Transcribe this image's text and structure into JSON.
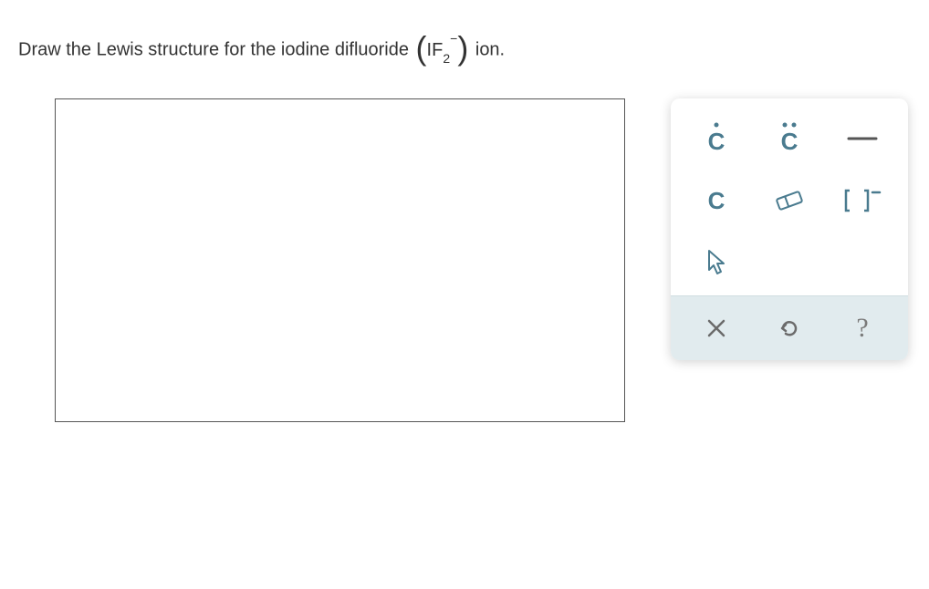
{
  "question": {
    "prefix": "Draw the Lewis structure for the iodine difluoride ",
    "formula_base": "IF",
    "formula_sub": "2",
    "formula_sup": "−",
    "suffix": " ion."
  },
  "tools": {
    "one_dot": "Ċ",
    "two_dot": "C̈",
    "bond": "—",
    "atom": "C",
    "eraser": "eraser",
    "brackets": "[ ]⁻",
    "pointer": "pointer",
    "clear": "×",
    "undo": "↶",
    "help": "?"
  }
}
